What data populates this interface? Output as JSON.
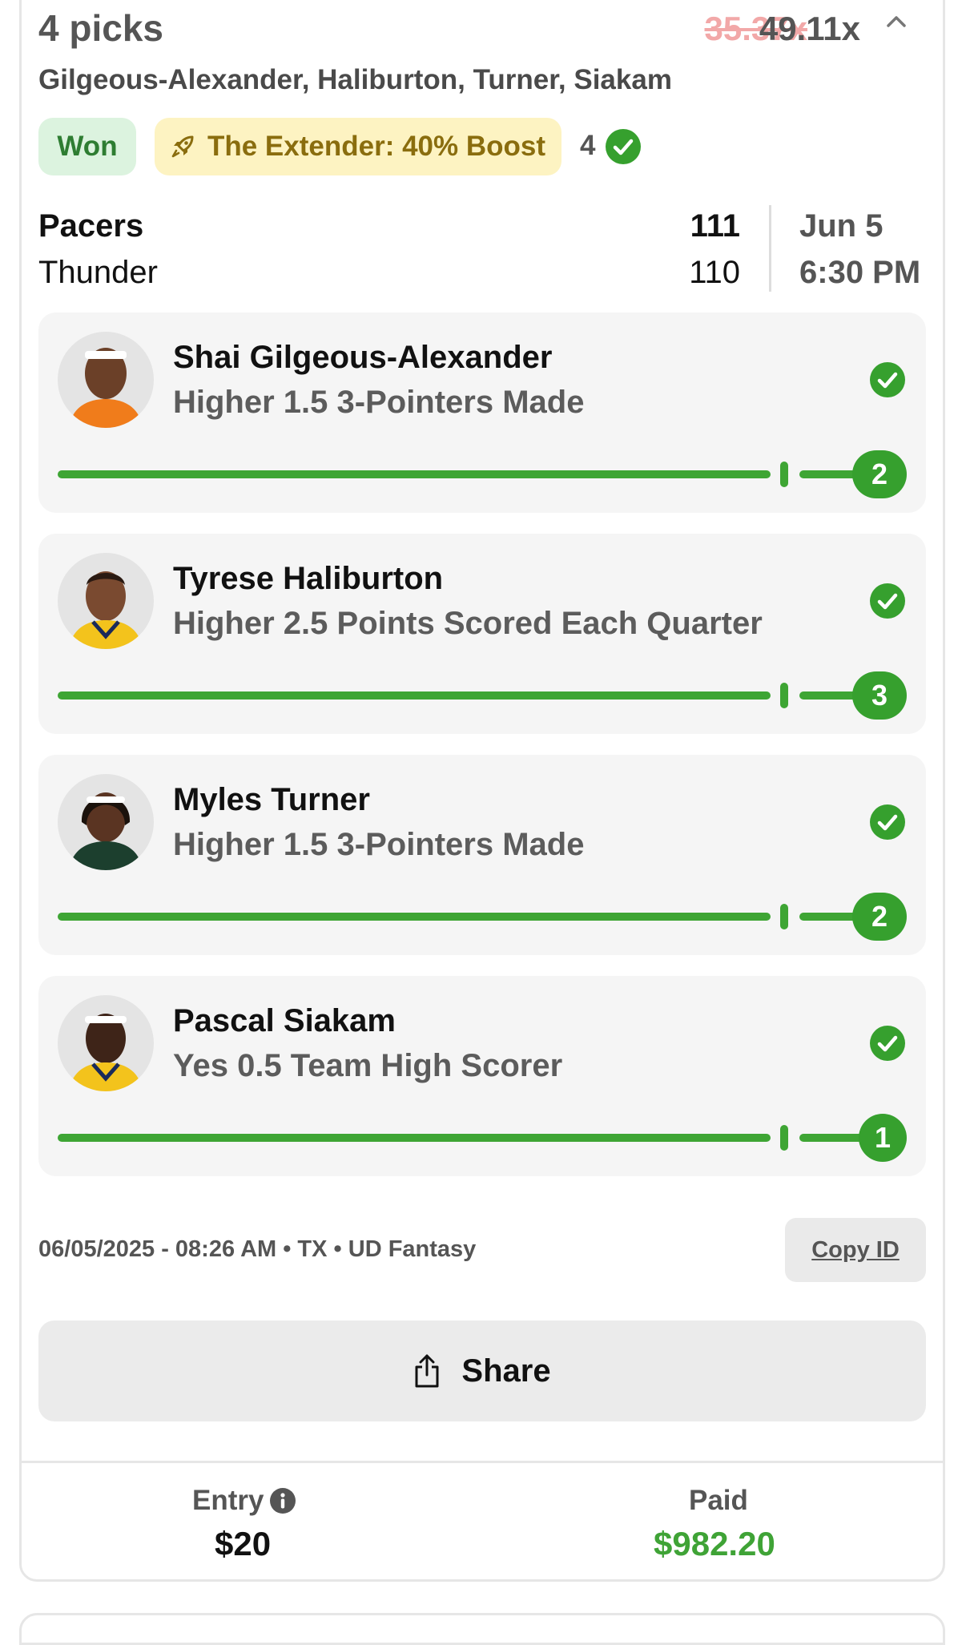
{
  "header": {
    "title": "4 picks",
    "old_multiplier": "35.37x",
    "new_multiplier": "49.11x",
    "player_names": "Gilgeous-Alexander, Haliburton, Turner, Siakam"
  },
  "badges": {
    "status": "Won",
    "boost": "The Extender: 40% Boost",
    "correct_count": "4"
  },
  "game": {
    "team1": "Pacers",
    "team1_score": "111",
    "team2": "Thunder",
    "team2_score": "110",
    "date": "Jun 5",
    "time": "6:30 PM"
  },
  "picks": [
    {
      "name": "Shai Gilgeous-Alexander",
      "line": "Higher 1.5  3-Pointers Made",
      "actual": "2",
      "jersey_color": "#f07c1b"
    },
    {
      "name": "Tyrese Haliburton",
      "line": "Higher 2.5  Points Scored Each Quarter",
      "actual": "3",
      "jersey_color": "#f3c31c"
    },
    {
      "name": "Myles Turner",
      "line": "Higher 1.5  3-Pointers Made",
      "actual": "2",
      "jersey_color": "#1c3f2e"
    },
    {
      "name": "Pascal Siakam",
      "line": "Yes 0.5  Team High Scorer",
      "actual": "1",
      "jersey_color": "#f3c31c"
    }
  ],
  "footer": {
    "meta": "06/05/2025 - 08:26 AM • TX • UD Fantasy",
    "copy_id": "Copy ID",
    "share": "Share",
    "entry_label": "Entry",
    "entry_value": "$20",
    "paid_label": "Paid",
    "paid_value": "$982.20"
  },
  "colors": {
    "accent_green": "#3ea534",
    "won_bg": "#dcf3df",
    "boost_bg": "#fdf3c2",
    "strike_red": "#f2a8a8"
  }
}
